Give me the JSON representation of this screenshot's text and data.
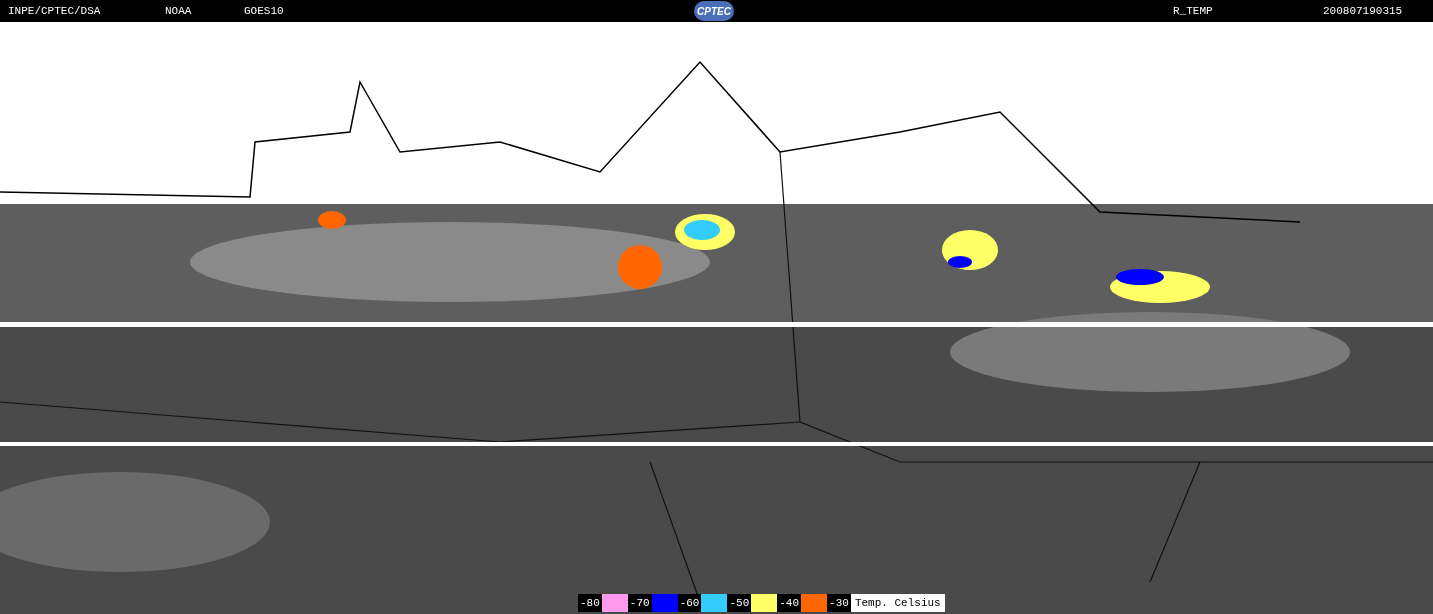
{
  "header": {
    "source": "INPE/CPTEC/DSA",
    "agency": "NOAA",
    "satellite": "GOES10",
    "logo": "CPTEC",
    "product": "R_TEMP",
    "timestamp": "200807190315"
  },
  "legend": {
    "ticks": [
      "-80",
      "-70",
      "-60",
      "-50",
      "-40",
      "-30"
    ],
    "swatches": [
      {
        "color": "#ff99ee"
      },
      {
        "color": "#0000ff"
      },
      {
        "color": "#33ccff"
      },
      {
        "color": "#ffff66"
      },
      {
        "color": "#ff6600"
      }
    ],
    "unit": "Temp. Celsius"
  }
}
